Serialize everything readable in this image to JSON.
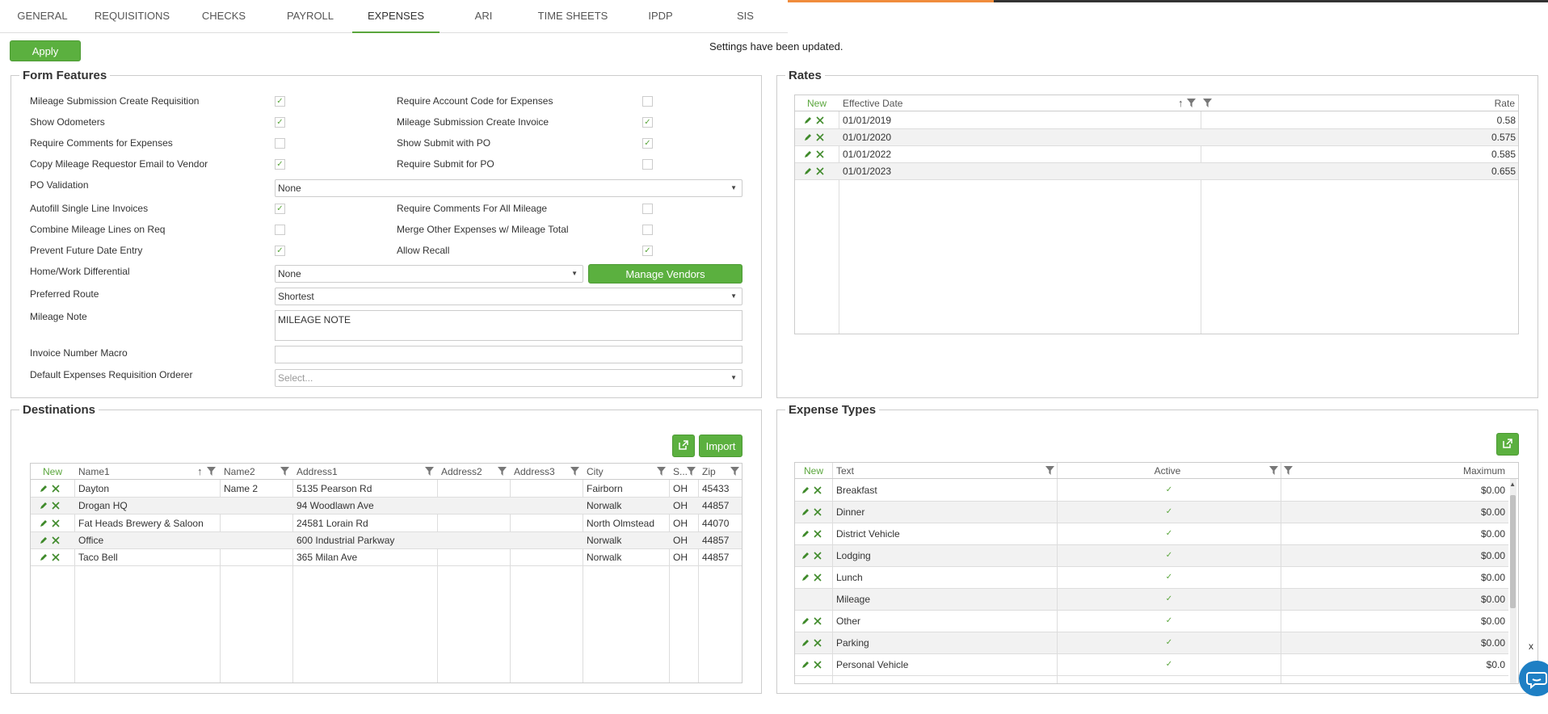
{
  "tabs": [
    {
      "label": "GENERAL"
    },
    {
      "label": "REQUISITIONS"
    },
    {
      "label": "CHECKS"
    },
    {
      "label": "PAYROLL"
    },
    {
      "label": "EXPENSES",
      "active": true
    },
    {
      "label": "ARI"
    },
    {
      "label": "TIME SHEETS"
    },
    {
      "label": "IPDP"
    },
    {
      "label": "SIS"
    }
  ],
  "apply_label": "Apply",
  "status_text": "Settings have been updated.",
  "form_features": {
    "title": "Form Features",
    "left": [
      {
        "label": "Mileage Submission Create Requisition",
        "checked": true
      },
      {
        "label": "Show Odometers",
        "checked": true
      },
      {
        "label": "Require Comments for Expenses",
        "checked": false
      },
      {
        "label": "Copy Mileage Requestor Email to Vendor",
        "checked": true
      }
    ],
    "right": [
      {
        "label": "Require Account Code for Expenses",
        "checked": false
      },
      {
        "label": "Mileage Submission Create Invoice",
        "checked": true
      },
      {
        "label": "Show Submit with PO",
        "checked": true
      },
      {
        "label": "Require Submit for PO",
        "checked": false
      }
    ],
    "po_validation": {
      "label": "PO Validation",
      "value": "None"
    },
    "left2": [
      {
        "label": "Autofill Single Line Invoices",
        "checked": true
      },
      {
        "label": "Combine Mileage Lines on Req",
        "checked": false
      },
      {
        "label": "Prevent Future Date Entry",
        "checked": true
      }
    ],
    "right2": [
      {
        "label": "Require Comments For All Mileage",
        "checked": false
      },
      {
        "label": "Merge Other Expenses w/ Mileage Total",
        "checked": false
      },
      {
        "label": "Allow Recall",
        "checked": true
      }
    ],
    "home_work": {
      "label": "Home/Work Differential",
      "value": "None"
    },
    "manage_vendors_label": "Manage Vendors",
    "preferred_route": {
      "label": "Preferred Route",
      "value": "Shortest"
    },
    "mileage_note": {
      "label": "Mileage Note",
      "value": "MILEAGE NOTE"
    },
    "invoice_macro": {
      "label": "Invoice Number Macro",
      "value": ""
    },
    "default_orderer": {
      "label": "Default Expenses Requisition Orderer",
      "placeholder": "Select..."
    }
  },
  "rates": {
    "title": "Rates",
    "headers": {
      "new": "New",
      "effective_date": "Effective Date",
      "rate": "Rate"
    },
    "rows": [
      {
        "date": "01/01/2019",
        "rate": "0.58"
      },
      {
        "date": "01/01/2020",
        "rate": "0.575"
      },
      {
        "date": "01/01/2022",
        "rate": "0.585"
      },
      {
        "date": "01/01/2023",
        "rate": "0.655"
      }
    ]
  },
  "destinations": {
    "title": "Destinations",
    "import_label": "Import",
    "headers": {
      "new": "New",
      "name1": "Name1",
      "name2": "Name2",
      "address1": "Address1",
      "address2": "Address2",
      "address3": "Address3",
      "city": "City",
      "state": "S...",
      "zip": "Zip"
    },
    "rows": [
      {
        "name1": "Dayton",
        "name2": "Name 2",
        "address1": "5135 Pearson Rd",
        "address2": "",
        "address3": "",
        "city": "Fairborn",
        "state": "OH",
        "zip": "45433"
      },
      {
        "name1": "Drogan HQ",
        "name2": "",
        "address1": "94 Woodlawn Ave",
        "address2": "",
        "address3": "",
        "city": "Norwalk",
        "state": "OH",
        "zip": "44857"
      },
      {
        "name1": "Fat Heads Brewery & Saloon",
        "name2": "",
        "address1": "24581 Lorain Rd",
        "address2": "",
        "address3": "",
        "city": "North Olmstead",
        "state": "OH",
        "zip": "44070"
      },
      {
        "name1": "Office",
        "name2": "",
        "address1": "600 Industrial Parkway",
        "address2": "",
        "address3": "",
        "city": "Norwalk",
        "state": "OH",
        "zip": "44857"
      },
      {
        "name1": "Taco Bell",
        "name2": "",
        "address1": "365 Milan Ave",
        "address2": "",
        "address3": "",
        "city": "Norwalk",
        "state": "OH",
        "zip": "44857"
      }
    ]
  },
  "expense_types": {
    "title": "Expense Types",
    "headers": {
      "new": "New",
      "text": "Text",
      "active": "Active",
      "maximum": "Maximum"
    },
    "rows": [
      {
        "text": "Breakfast",
        "active": true,
        "maximum": "$0.00",
        "editable": true
      },
      {
        "text": "Dinner",
        "active": true,
        "maximum": "$0.00",
        "editable": true
      },
      {
        "text": "District Vehicle",
        "active": true,
        "maximum": "$0.00",
        "editable": true
      },
      {
        "text": "Lodging",
        "active": true,
        "maximum": "$0.00",
        "editable": true
      },
      {
        "text": "Lunch",
        "active": true,
        "maximum": "$0.00",
        "editable": true
      },
      {
        "text": "Mileage",
        "active": true,
        "maximum": "$0.00",
        "editable": false
      },
      {
        "text": "Other",
        "active": true,
        "maximum": "$0.00",
        "editable": true
      },
      {
        "text": "Parking",
        "active": true,
        "maximum": "$0.00",
        "editable": true
      },
      {
        "text": "Personal Vehicle",
        "active": true,
        "maximum": "$0.0",
        "editable": true
      }
    ]
  },
  "chat_close": "x",
  "colors": {
    "accent": "#5bb03f",
    "orange": "#f08c3c",
    "chat": "#1e7fc4"
  }
}
